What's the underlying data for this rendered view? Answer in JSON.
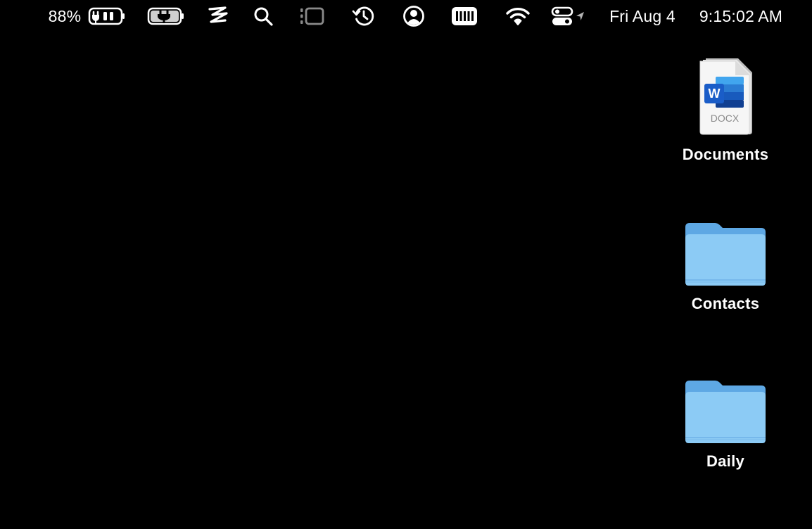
{
  "menubar": {
    "battery_percent": "88%",
    "date": "Fri Aug 4",
    "time": "9:15:02 AM",
    "icons": [
      "battery-charging-icon",
      "battery-plug-icon",
      "lightning-z-icon",
      "search-icon",
      "stage-manager-icon",
      "time-machine-icon",
      "user-account-icon",
      "keyboard-meter-icon",
      "wifi-icon",
      "control-center-icon",
      "location-arrow-icon"
    ]
  },
  "desktop": {
    "items": [
      {
        "label": "Documents",
        "icon": "docx-file-icon",
        "badge": "DOCX",
        "letter": "W"
      },
      {
        "label": "Contacts",
        "icon": "folder-icon"
      },
      {
        "label": "Daily",
        "icon": "folder-icon"
      }
    ]
  },
  "colors": {
    "background": "#000000",
    "folder_front": "#8ccbf5",
    "folder_back": "#5ea8e4",
    "word_blue": "#1a5dc8"
  }
}
